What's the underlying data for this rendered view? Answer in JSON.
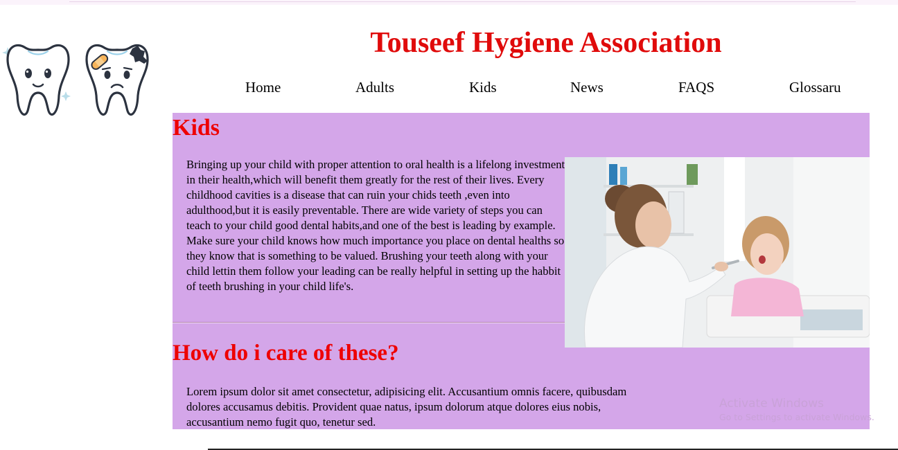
{
  "header": {
    "title": "Touseef Hygiene Association",
    "logo_icon": "teeth-icon"
  },
  "nav": {
    "items": [
      {
        "label": "Home"
      },
      {
        "label": "Adults"
      },
      {
        "label": "Kids"
      },
      {
        "label": "News"
      },
      {
        "label": "FAQS"
      },
      {
        "label": "Glossaru"
      }
    ]
  },
  "main": {
    "kids_heading": "Kids",
    "kids_text": "Bringing up your child with proper attention to oral health is a lifelong investment in their health,which will benefit them greatly for the rest of their lives. Every childhood cavities is a disease that can ruin your chids teeth ,even into adulthood,but it is easily preventable. There are wide variety of steps you can teach to your child good dental habits,and one of the best is leading by example. Make sure your child knows how much importance you place on dental healths so they know that is something to be valued. Brushing your teeth along with your child lettin them follow your leading can be really helpful in setting up the habbit of teeth brushing in your child life's.",
    "care_heading": "How do i care of these?",
    "care_text": "Lorem ipsum dolor sit amet consectetur, adipisicing elit. Accusantium omnis facere, quibusdam dolores accusamus debitis. Provident quae natus, ipsum dolorum atque dolores eius nobis, accusantium nemo fugit quo, tenetur sed."
  },
  "watermark": {
    "line1": "Activate Windows",
    "line2": "Go to Settings to activate Windows."
  },
  "colors": {
    "title": "#e00b0b",
    "heading": "#ee0000",
    "content_bg": "#d4a6e9"
  }
}
